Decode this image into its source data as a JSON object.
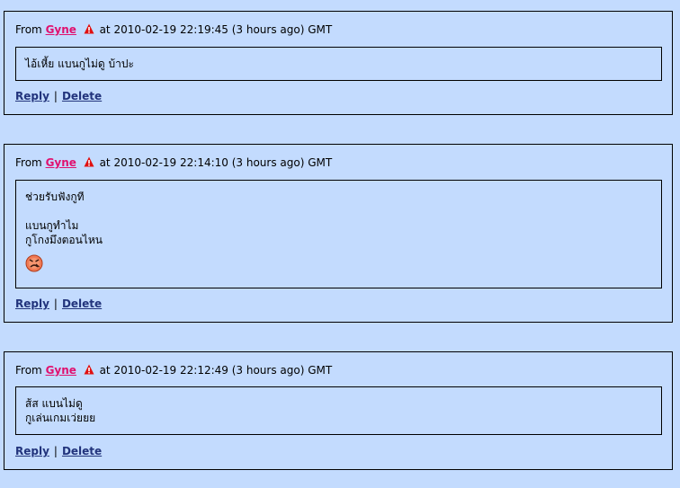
{
  "comments": [
    {
      "from_label": "From",
      "author": "Gyne",
      "time_text": "at 2010-02-19 22:19:45 (3 hours ago) GMT",
      "lines": [
        "ไอ้เหี้ย แบนกูไม่ดู บ้าปะ"
      ],
      "reply_label": "Reply",
      "separator": "|",
      "delete_label": "Delete"
    },
    {
      "from_label": "From",
      "author": "Gyne",
      "time_text": "at 2010-02-19 22:14:10 (3 hours ago) GMT",
      "lines": [
        "ช่วยรับฟังกูที",
        "",
        "แบนกูทำไม",
        "กูโกงมึงตอนไหน"
      ],
      "emoticon": "angry-face-emoticon",
      "reply_label": "Reply",
      "separator": "|",
      "delete_label": "Delete"
    },
    {
      "from_label": "From",
      "author": "Gyne",
      "time_text": "at 2010-02-19 22:12:49 (3 hours ago) GMT",
      "lines": [
        "ส้ส แบนไม่ดู",
        "กูเล่นเกมเว่ยยย"
      ],
      "reply_label": "Reply",
      "separator": "|",
      "delete_label": "Delete"
    }
  ],
  "colors": {
    "background": "#c3dbfe",
    "author_link": "#e0116f",
    "action_link": "#22347c",
    "warning_icon": "#e01010"
  },
  "icons": {
    "warning": "warning-icon"
  }
}
